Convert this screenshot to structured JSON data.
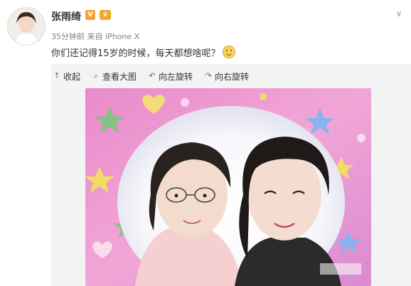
{
  "post": {
    "author": "张雨绮",
    "verified_badge": "V",
    "member_badge": "♛",
    "time": "35分钟前",
    "source_prefix": "来自",
    "source": "iPhone X",
    "text": "你们还记得15岁的时候，每天都想啥呢？",
    "emoji_icon": "smile-emoji-icon"
  },
  "toolbar": {
    "items": [
      {
        "label": "收起",
        "icon": "collapse-icon"
      },
      {
        "label": "查看大图",
        "icon": "search-icon"
      },
      {
        "label": "向左旋转",
        "icon": "rotate-left-icon"
      },
      {
        "label": "向右旋转",
        "icon": "rotate-right-icon"
      }
    ]
  },
  "colors": {
    "accent_badge": "#f7a13a",
    "text_primary": "#333333",
    "text_secondary": "#808080"
  }
}
